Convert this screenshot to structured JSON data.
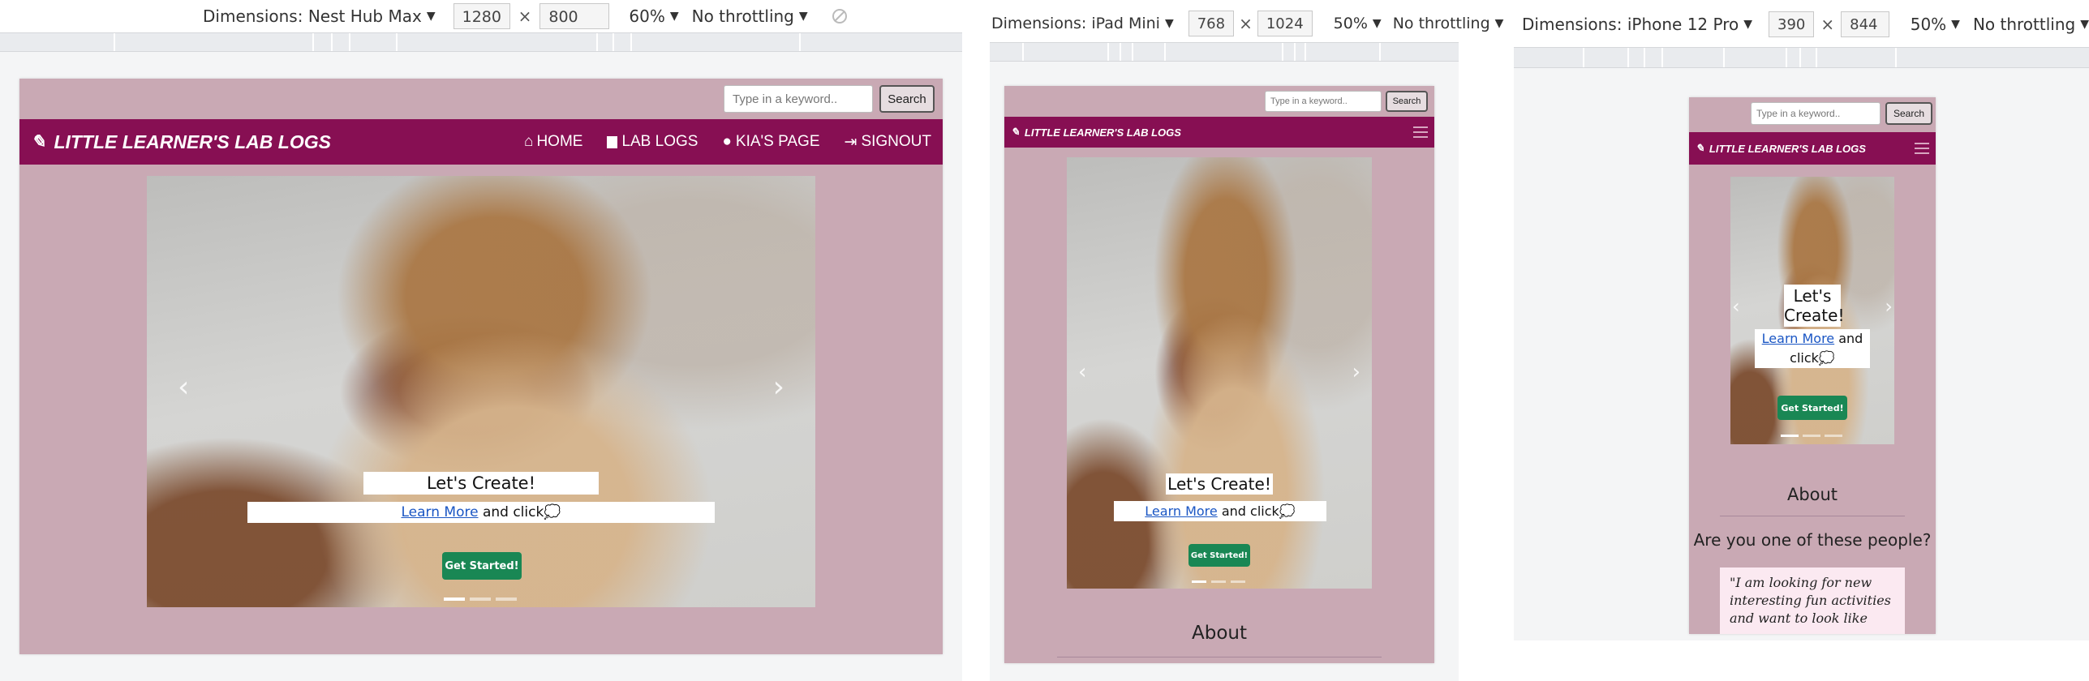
{
  "devtools": [
    {
      "dimensions_label": "Dimensions: Nest Hub Max",
      "width": "1280",
      "height": "800",
      "zoom": "60%",
      "throttling": "No throttling"
    },
    {
      "dimensions_label": "Dimensions: iPad Mini",
      "width": "768",
      "height": "1024",
      "zoom": "50%",
      "throttling": "No throttling"
    },
    {
      "dimensions_label": "Dimensions: iPhone 12 Pro",
      "width": "390",
      "height": "844",
      "zoom": "50%",
      "throttling": "No throttling"
    }
  ],
  "dimension_separator": "×",
  "site": {
    "search_placeholder": "Type in a keyword..",
    "search_button": "Search",
    "brand": "LITTLE LEARNER'S LAB LOGS",
    "nav": [
      {
        "label": "HOME",
        "icon": "home-icon"
      },
      {
        "label": "LAB LOGS",
        "icon": "book-icon"
      },
      {
        "label": "KIA'S PAGE",
        "icon": "user-icon"
      },
      {
        "label": "SIGNOUT",
        "icon": "sign-out-icon"
      }
    ],
    "hero_title": "Let's Create!",
    "hero_link": "Learn More",
    "hero_tail": " and click",
    "hero_tail_glyph": "💭",
    "cta": "Get Started!",
    "about": "About",
    "question": "Are you one of these people?",
    "quote": "\"I am looking for new interesting fun activities and want to look like"
  },
  "colors": {
    "navbar": "#870f53",
    "page": "#c9a9b4",
    "cta": "#198754",
    "quote_bg": "#fbe9f1"
  }
}
